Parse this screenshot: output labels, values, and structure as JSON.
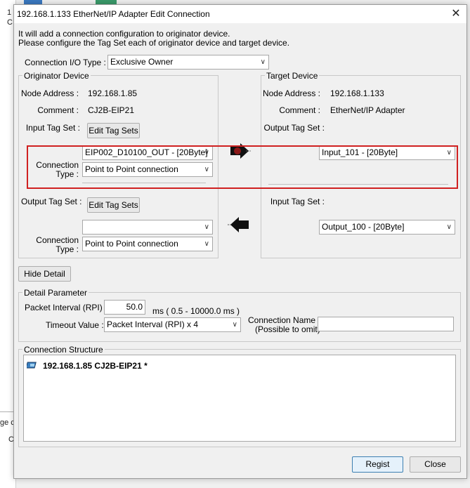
{
  "background": {
    "fragment_1": "1",
    "fragment_2": "C",
    "fragment_3": "ge c",
    "fragment_4": "C"
  },
  "dialog": {
    "title": "192.168.1.133 EtherNet/IP Adapter Edit Connection",
    "intro_line1": "It will add a connection configuration to originator device.",
    "intro_line2": "Please configure the Tag Set each of originator device and target device.",
    "connection_io_type_label": "Connection I/O Type :",
    "connection_io_type_value": "Exclusive Owner"
  },
  "originator": {
    "group_label": "Originator Device",
    "node_address_label": "Node Address :",
    "node_address_value": "192.168.1.85",
    "comment_label": "Comment :",
    "comment_value": "CJ2B-EIP21",
    "input_tag_set_label": "Input Tag Set :",
    "edit_tag_sets_label": "Edit Tag Sets",
    "input_tag_value": "EIP002_D10100_OUT - [20Byte]",
    "connection_type_label_1": "Connection",
    "connection_type_label_2": "Type :",
    "input_connection_type_value": "Point to Point connection",
    "output_tag_set_label": "Output Tag Set :",
    "output_edit_tag_sets_label": "Edit Tag Sets",
    "output_tag_value": "",
    "output_connection_type_label_1": "Connection",
    "output_connection_type_label_2": "Type :",
    "output_connection_type_value": "Point to Point connection"
  },
  "target": {
    "group_label": "Target Device",
    "node_address_label": "Node Address :",
    "node_address_value": "192.168.1.133",
    "comment_label": "Comment :",
    "comment_value": "EtherNet/IP Adapter",
    "output_tag_set_label": "Output Tag Set :",
    "output_tag_value": "Input_101 - [20Byte]",
    "input_tag_set_label": "Input Tag Set :",
    "input_tag_value": "Output_100 - [20Byte]"
  },
  "hide_detail_label": "Hide Detail",
  "detail": {
    "group_label": "Detail Parameter",
    "packet_interval_label": "Packet Interval (RPI) :",
    "packet_interval_value": "50.0",
    "packet_interval_unit": "ms ( 0.5 - 10000.0 ms )",
    "timeout_label": "Timeout Value :",
    "timeout_value": "Packet Interval (RPI) x 4",
    "connection_name_label": "Connection Name :",
    "connection_name_hint": "(Possible to omit)",
    "connection_name_value": ""
  },
  "structure": {
    "group_label": "Connection Structure",
    "root_node": "192.168.1.85 CJ2B-EIP21 *"
  },
  "footer": {
    "regist_label": "Regist",
    "close_label": "Close"
  },
  "colors": {
    "highlight_red": "#d02020",
    "default_button_border": "#3c7fb1"
  }
}
